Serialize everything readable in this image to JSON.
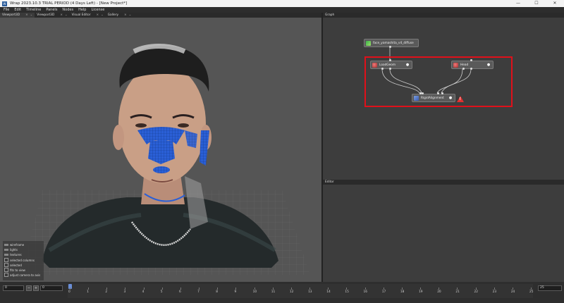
{
  "window": {
    "title": "Wrap 2023.10.3  TRIAL PERIOD (4 Days Left) - [New Project*]",
    "minimize": "—",
    "maximize": "☐",
    "close": "✕"
  },
  "menu": [
    "File",
    "Edit",
    "Timeline",
    "Panels",
    "Nodes",
    "Help",
    "License"
  ],
  "tabs": [
    {
      "label": "Viewport3D"
    },
    {
      "label": "Viewport3D"
    },
    {
      "label": "Visual Editor"
    },
    {
      "label": "Gallery"
    }
  ],
  "graph": {
    "title": "Graph",
    "nodes": {
      "texture": "face_yamashita_v4_diffuse",
      "load_geom": "LoadGeom",
      "head": "Head",
      "rigid_alignment": "RigidAlignment"
    }
  },
  "editor": {
    "title": "Editor"
  },
  "viewport_options": [
    {
      "label": "wireframe",
      "type": "bar"
    },
    {
      "label": "lights",
      "type": "bar"
    },
    {
      "label": "textures",
      "type": "bar"
    },
    {
      "label": "selected columns",
      "type": "check"
    },
    {
      "label": "selected",
      "type": "check"
    },
    {
      "label": "fits to view",
      "type": "check"
    },
    {
      "label": "adjust camera to axis",
      "type": "check"
    }
  ],
  "timeline": {
    "start_frame": "0",
    "current_frame": "0",
    "end_frame": "25",
    "minus_label": "−",
    "plus_label": "+",
    "ticks": [
      "0",
      "1",
      "2",
      "3",
      "4",
      "5",
      "6",
      "7",
      "8",
      "9",
      "10",
      "11",
      "12",
      "13",
      "14",
      "15",
      "16",
      "17",
      "18",
      "19",
      "20",
      "21",
      "22",
      "23",
      "24",
      "25"
    ]
  },
  "colors": {
    "selection_outline": "#e0101a",
    "warning": "#e03030",
    "mesh_blue": "#2a5fd6"
  }
}
